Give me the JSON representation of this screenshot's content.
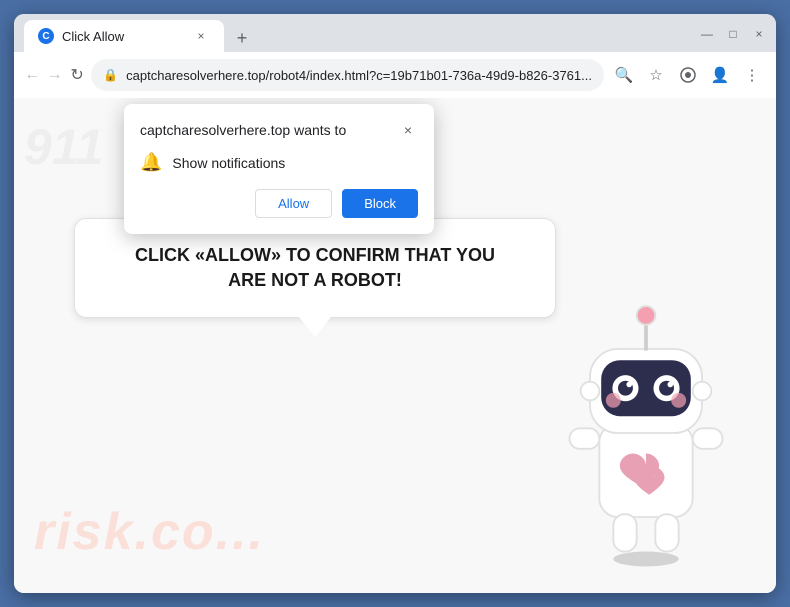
{
  "browser": {
    "tab": {
      "favicon": "●",
      "title": "Click Allow",
      "close": "×"
    },
    "new_tab": "+",
    "window_controls": {
      "minimize": "—",
      "maximize": "□",
      "close": "×"
    },
    "nav": {
      "back": "←",
      "forward": "→",
      "refresh": "↻",
      "lock": "🔒",
      "address": "captcharesolverhere.top/robot4/index.html?c=19b71b01-736a-49d9-b826-3761...",
      "search_icon": "🔍",
      "star_icon": "☆",
      "profile_icon": "👤",
      "menu_icon": "⋮",
      "extension_icon": "⬛"
    }
  },
  "popup": {
    "title": "captcharesolverhere.top wants to",
    "close": "×",
    "notification_label": "Show notifications",
    "allow_btn": "Allow",
    "block_btn": "Block"
  },
  "page": {
    "main_message_line1": "CLICK «ALLOW» TO CONFIRM THAT YOU",
    "main_message_line2": "ARE NOT A ROBOT!",
    "watermark": "risk.co..."
  }
}
